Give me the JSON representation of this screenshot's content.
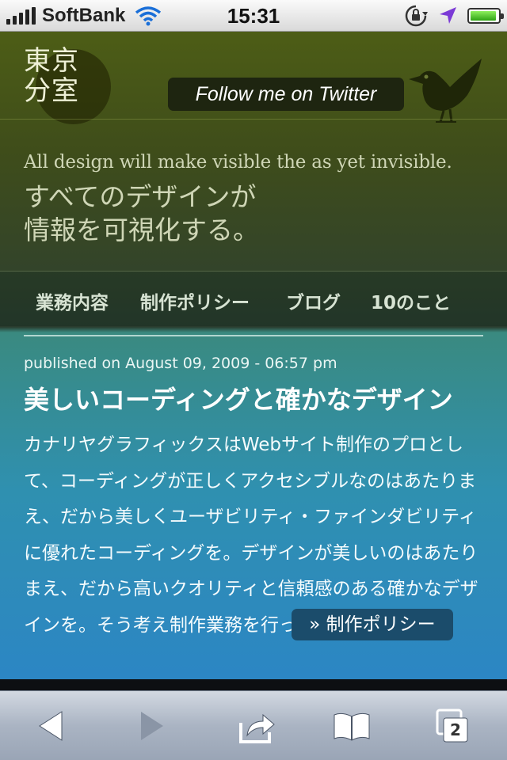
{
  "status_bar": {
    "carrier": "SoftBank",
    "time": "15:31",
    "icons": [
      "signal-bars-icon",
      "wifi-icon",
      "rotation-lock-icon",
      "location-arrow-icon",
      "battery-icon"
    ]
  },
  "header": {
    "logo_line1": "東京",
    "logo_line2": "分室",
    "twitter_label": "Follow me on Twitter"
  },
  "tagline": {
    "english": "All design will make visible the as yet invisible.",
    "japanese_line1": "すべてのデザインが",
    "japanese_line2": "情報を可視化する。"
  },
  "nav": {
    "items": [
      {
        "label": "業務内容"
      },
      {
        "label": "制作ポリシー"
      },
      {
        "label": "ブログ"
      },
      {
        "label": "10のこと"
      }
    ]
  },
  "article": {
    "meta": "published on August 09, 2009 - 06:57 pm",
    "title": "美しいコーディングと確かなデザイン",
    "body": "カナリヤグラフィックスはWebサイト制作のプロとして、コーディングが正しくアクセシブルなのはあたりまえ、だから美しくユーザビリティ・ファインダビリティに優れたコーディングを。デザインが美しいのはあたりまえ、だから高いクオリティと信頼感のある確かなデザインを。そう考え制作業務を行っています。",
    "link_label": "» 制作ポリシー"
  },
  "toolbar": {
    "pages_count": "2",
    "icons": [
      "back-icon",
      "forward-icon",
      "share-icon",
      "bookmarks-icon",
      "pages-icon"
    ]
  },
  "colors": {
    "header_olive": "#4d5d16",
    "content_blue": "#2c86c4",
    "button_dark": "#1e2510",
    "policy_button": "#1b4c6b"
  }
}
